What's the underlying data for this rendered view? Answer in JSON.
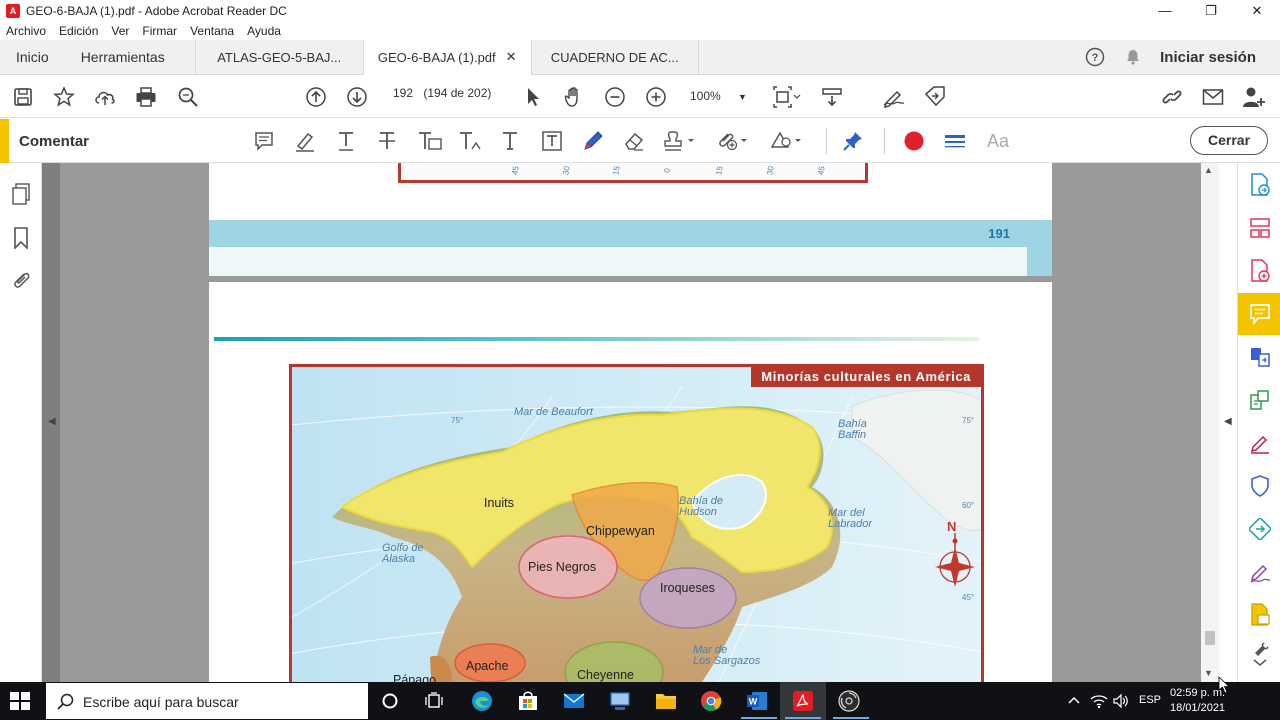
{
  "window": {
    "title": "GEO-6-BAJA (1).pdf - Adobe Acrobat Reader DC",
    "minimize": "—",
    "maximize": "❐",
    "close": "✕"
  },
  "menu": [
    "Archivo",
    "Edición",
    "Ver",
    "Firmar",
    "Ventana",
    "Ayuda"
  ],
  "tabs": {
    "home": "Inicio",
    "tools": "Herramientas",
    "documents": [
      {
        "label": "ATLAS-GEO-5-BAJ..."
      },
      {
        "label": "GEO-6-BAJA (1).pdf",
        "active": true,
        "close": "✕"
      },
      {
        "label": "CUADERNO DE AC..."
      }
    ],
    "sign_in": "Iniciar sesión"
  },
  "toolbar": {
    "page_number": "192",
    "page_info": "(194 de 202)",
    "zoom": "100%"
  },
  "comment_bar": {
    "label": "Comentar",
    "close": "Cerrar",
    "text_size_label": "Aa"
  },
  "document": {
    "top_page_degrees": [
      "45",
      "30",
      "15",
      "0",
      "15",
      "30",
      "45"
    ],
    "page_number_label": "191",
    "map": {
      "title": "Minorías culturales en América",
      "water_labels": [
        {
          "text": "Mar de Beaufort"
        },
        {
          "text": "Bahía\nBaffin"
        },
        {
          "text": "Bahía de\nHudson"
        },
        {
          "text": "Mar del\nLabrador"
        },
        {
          "text": "Golfo de\nAlaska"
        },
        {
          "text": "Mar de\nLos Sargazos"
        }
      ],
      "degree_labels": [
        "75°",
        "75°",
        "60°",
        "45°"
      ],
      "compass": "N",
      "groups": [
        "Inuits",
        "Chippewyan",
        "Pies Negros",
        "Iroqueses",
        "Apache",
        "Cheyenne",
        "Pápago"
      ]
    }
  },
  "taskbar": {
    "search_placeholder": "Escribe aquí para buscar",
    "language": "ESP",
    "time": "02:59 p. m.",
    "date": "18/01/2021"
  },
  "colors": {
    "accent_yellow": "#f5c400",
    "map_border": "#b5362a",
    "band_blue": "#9fd5e2",
    "taskbar": "#0f1114"
  }
}
